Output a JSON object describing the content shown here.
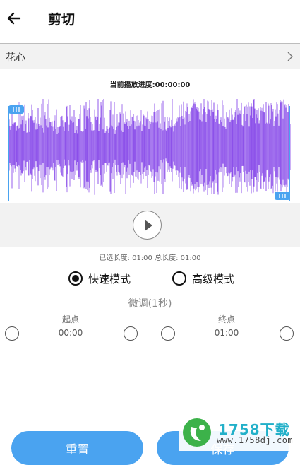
{
  "app_bar": {
    "title": "剪切"
  },
  "file": {
    "name": "花心"
  },
  "progress": {
    "text": "当前播放进度:00:00:00"
  },
  "waveform": {
    "color": "#8a4dea",
    "handle_color": "#4aa3f0",
    "selection_start_fraction": 0,
    "selection_end_fraction": 1
  },
  "length": {
    "text": "已选长度: 01:00 总长度: 01:00"
  },
  "modes": {
    "fast": {
      "label": "快速模式",
      "selected": true
    },
    "advanced": {
      "label": "高级模式",
      "selected": false
    }
  },
  "fine_tune": {
    "title": "微调(1秒)",
    "start": {
      "label": "起点",
      "value": "00:00"
    },
    "end": {
      "label": "终点",
      "value": "01:00"
    }
  },
  "buttons": {
    "reset": "重置",
    "save": "保存"
  },
  "watermark": {
    "brand": "1758下载",
    "url": "www.1758dj.com"
  },
  "colors": {
    "accent": "#4aa3f0",
    "wave": "#8a4dea"
  }
}
